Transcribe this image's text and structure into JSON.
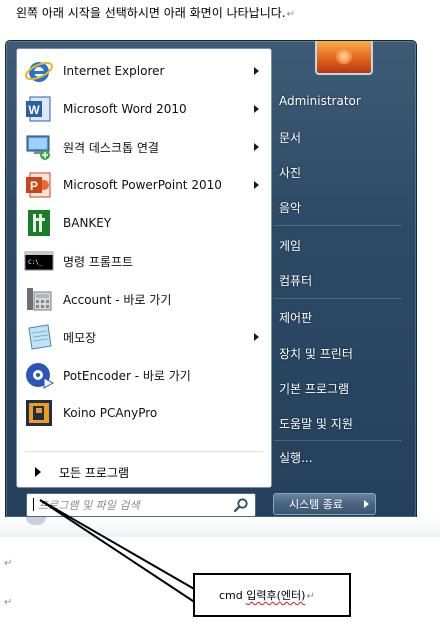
{
  "document": {
    "instruction": "왼쪽 아래 시작을 선택하시면 아래 화면이 나타납니다.",
    "paragraph_mark": "↵"
  },
  "start_menu": {
    "programs": [
      {
        "label": "Internet Explorer",
        "icon": "internet-explorer-icon",
        "submenu": true
      },
      {
        "label": "Microsoft Word 2010",
        "icon": "word-icon",
        "submenu": true
      },
      {
        "label": "원격 데스크톱 연결",
        "icon": "remote-desktop-icon",
        "submenu": true
      },
      {
        "label": "Microsoft PowerPoint 2010",
        "icon": "powerpoint-icon",
        "submenu": true
      },
      {
        "label": "BANKEY",
        "icon": "bankey-icon",
        "submenu": false
      },
      {
        "label": "명령 프롬프트",
        "icon": "command-prompt-icon",
        "submenu": false
      },
      {
        "label": "Account - 바로 가기",
        "icon": "account-shortcut-icon",
        "submenu": false
      },
      {
        "label": "메모장",
        "icon": "notepad-icon",
        "submenu": true
      },
      {
        "label": "PotEncoder - 바로 가기",
        "icon": "potencoder-icon",
        "submenu": false
      },
      {
        "label": "Koino PCAnyPro",
        "icon": "pcanypro-icon",
        "submenu": false
      }
    ],
    "all_programs": "모든 프로그램",
    "search_placeholder": "프로그램 및 파일 검색",
    "right_items": [
      "Administrator",
      "문서",
      "사진",
      "음악",
      "게임",
      "컴퓨터",
      "제어판",
      "장치 및 프린터",
      "기본 프로그램",
      "도움말 및 지원",
      "실행..."
    ],
    "shutdown_label": "시스템 종료"
  },
  "callout": {
    "text_cmd": "cmd",
    "text_rest": "입력후(엔터)"
  },
  "colors": {
    "menu_blue": "#2c4a66",
    "accent_red": "#d21a1a"
  }
}
